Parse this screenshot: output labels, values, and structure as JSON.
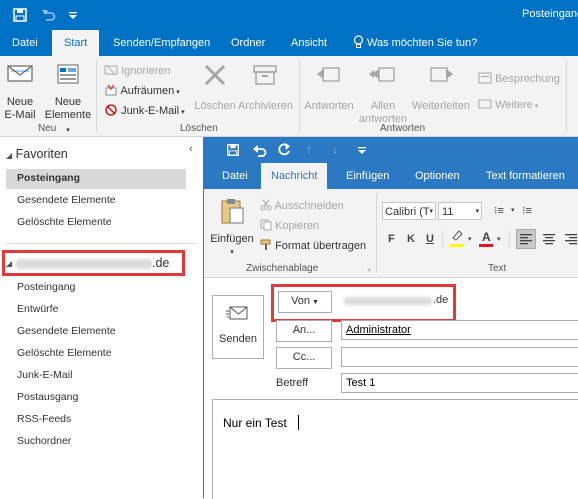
{
  "titlebar": {
    "app_title": "Posteingang"
  },
  "main_tabs": [
    "Datei",
    "Start",
    "Senden/Empfangen",
    "Ordner",
    "Ansicht",
    "Was möchten Sie tun?"
  ],
  "ribbon": {
    "new_email": "Neue E-Mail",
    "new_email_l1": "Neue",
    "new_email_l2": "E-Mail",
    "new_items_l1": "Neue",
    "new_items_l2": "Elemente",
    "group_new": "Neu",
    "ignore": "Ignorieren",
    "cleanup": "Aufräumen",
    "junk": "Junk-E-Mail",
    "delete": "Löschen",
    "archive": "Archivieren",
    "group_delete": "Löschen",
    "reply": "Antworten",
    "reply_all_l1": "Allen",
    "reply_all_l2": "antworten",
    "forward": "Weiterleiten",
    "meeting": "Besprechung",
    "more": "Weitere",
    "group_respond": "Antworten"
  },
  "favorites": {
    "header": "Favoriten",
    "items": [
      "Posteingang",
      "Gesendete Elemente",
      "Gelöschte Elemente"
    ]
  },
  "account": {
    "suffix": ".de",
    "folders": [
      "Posteingang",
      "Entwürfe",
      "Gesendete Elemente",
      "Gelöschte Elemente",
      "Junk-E-Mail",
      "Postausgang",
      "RSS-Feeds",
      "Suchordner"
    ]
  },
  "compose": {
    "tabs": [
      "Datei",
      "Nachricht",
      "Einfügen",
      "Optionen",
      "Text formatieren"
    ],
    "paste": "Einfügen",
    "cut": "Ausschneiden",
    "copy": "Kopieren",
    "format_painter": "Format übertragen",
    "group_clipboard": "Zwischenablage",
    "font_name": "Calibri (T",
    "font_size": "11",
    "group_text": "Text",
    "bold": "F",
    "italic": "K",
    "underline": "U",
    "send": "Senden",
    "from_btn": "Von",
    "from_suffix": ".de",
    "to_btn": "An...",
    "cc_btn": "Cc...",
    "to_value": "Administrator",
    "subject_label": "Betreff",
    "subject_value": "Test 1",
    "body": "Nur ein Test"
  },
  "colors": {
    "accent": "#0072c6",
    "compose_accent": "#2b79c2",
    "highlight": "#e2393a"
  }
}
